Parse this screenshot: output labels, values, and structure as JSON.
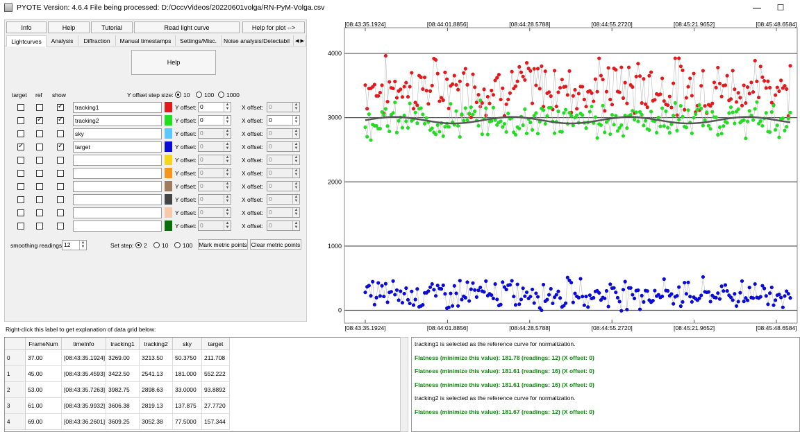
{
  "window": {
    "title": "PYOTE Version: 4.6.4  File being processed: D:/OccvVideos/20220601volga/RN-PyM-Volga.csv",
    "minimize": "—",
    "maximize": "☐"
  },
  "toolbar": {
    "info": "Info",
    "help": "Help",
    "tutorial": "Tutorial",
    "read_light_curve": "Read light curve",
    "help_for_plot": "Help for plot -->"
  },
  "tabs": [
    "Lightcurves",
    "Analysis",
    "Diffraction",
    "Manual timestamps",
    "Settings/Misc.",
    "Noise analysis/Detectabil"
  ],
  "tab_scroll": "◀ ▶",
  "lightcurves": {
    "help_button": "Help",
    "col_target": "target",
    "col_ref": "ref",
    "col_show": "show",
    "y_offset_step_label": "Y offset step size:",
    "y_offset_steps": [
      "10",
      "100",
      "1000"
    ],
    "y_offset_label": "Y offset:",
    "x_offset_label": "X offset:",
    "rows": [
      {
        "name": "tracking1",
        "color": "#e31a1c",
        "target": false,
        "ref": false,
        "show": true,
        "y_offset": "0",
        "x_offset": "0"
      },
      {
        "name": "tracking2",
        "color": "#22dd22",
        "target": false,
        "ref": true,
        "show": true,
        "y_offset": "0",
        "x_offset": "0"
      },
      {
        "name": "sky",
        "color": "#5ac8fa",
        "target": false,
        "ref": false,
        "show": false,
        "y_offset": "0",
        "x_offset": "0"
      },
      {
        "name": "target",
        "color": "#0b0bd6",
        "target": true,
        "ref": false,
        "show": true,
        "y_offset": "0",
        "x_offset": "0"
      },
      {
        "name": "",
        "color": "#f5d61a",
        "target": false,
        "ref": false,
        "show": false,
        "y_offset": "0",
        "x_offset": "0"
      },
      {
        "name": "",
        "color": "#f7941d",
        "target": false,
        "ref": false,
        "show": false,
        "y_offset": "0",
        "x_offset": "0"
      },
      {
        "name": "",
        "color": "#a07a5a",
        "target": false,
        "ref": false,
        "show": false,
        "y_offset": "0",
        "x_offset": "0"
      },
      {
        "name": "",
        "color": "#444444",
        "target": false,
        "ref": false,
        "show": false,
        "y_offset": "0",
        "x_offset": "0"
      },
      {
        "name": "",
        "color": "#f7c9a8",
        "target": false,
        "ref": false,
        "show": false,
        "y_offset": "0",
        "x_offset": "0"
      },
      {
        "name": "",
        "color": "#0a6e0a",
        "target": false,
        "ref": false,
        "show": false,
        "y_offset": "0",
        "x_offset": "0"
      }
    ],
    "smoothing_label": "smoothing readings",
    "smoothing_value": "12",
    "set_step_label": "Set step:",
    "set_steps": [
      "2",
      "10",
      "100"
    ],
    "mark_metric": "Mark metric points",
    "clear_metric": "Clear metric points"
  },
  "grid_hint": "Right-click this label to get explanation of data grid below:",
  "table": {
    "columns": [
      "FrameNum",
      "timeInfo",
      "tracking1",
      "tracking2",
      "sky",
      "target"
    ],
    "rows": [
      [
        "37.00",
        "[08:43:35.1924]",
        "3269.00",
        "3213.50",
        "50.3750",
        "211.708"
      ],
      [
        "45.00",
        "[08:43:35.4593]",
        "3422.50",
        "2541.13",
        "181.000",
        "552.222"
      ],
      [
        "53.00",
        "[08:43:35.7263]",
        "3982.75",
        "2898.63",
        "33.0000",
        "93.8892"
      ],
      [
        "61.00",
        "[08:43:35.9932]",
        "3606.38",
        "2819.13",
        "137.875",
        "27.7720"
      ],
      [
        "69.00",
        "[08:43:36.2601]",
        "3609.25",
        "3052.38",
        "77.5000",
        "157.344"
      ]
    ],
    "row_index": [
      "0",
      "1",
      "2",
      "3",
      "4"
    ]
  },
  "log": [
    {
      "text": "tracking1 is selected as the reference curve for normalization.",
      "green": false
    },
    {
      "text": "Flatness (minimize this value): 181.78 (readings: 12) (X offset: 0)",
      "green": true
    },
    {
      "text": "Flatness (minimize this value): 181.61 (readings: 16) (X offset: 0)",
      "green": true
    },
    {
      "text": "Flatness (minimize this value): 181.61 (readings: 16) (X offset: 0)",
      "green": true
    },
    {
      "text": "tracking2 is selected as the reference curve for normalization.",
      "green": false
    },
    {
      "text": "Flatness (minimize this value): 181.67 (readings: 12) (X offset: 0)",
      "green": true
    }
  ],
  "chart_data": {
    "type": "scatter",
    "x_tick_labels": [
      "[08:43:35.1924]",
      "[08:44:01.8856]",
      "[08:44:28.5788]",
      "[08:44:55.2720]",
      "[08:45:21.9652]",
      "[08:45:48.6584]"
    ],
    "y_ticks": [
      0,
      1000,
      2000,
      3000,
      4000
    ],
    "ylim": [
      -200,
      4400
    ],
    "grid": true,
    "series": [
      {
        "name": "tracking1",
        "color": "#e31a1c",
        "mean": 3480,
        "spread": 380
      },
      {
        "name": "tracking2",
        "color": "#22dd22",
        "mean": 2960,
        "spread": 230
      },
      {
        "name": "target",
        "color": "#0b0bd6",
        "mean": 260,
        "spread": 200
      }
    ],
    "smoothed_line": {
      "color": "#555555",
      "mean": 2960,
      "amplitude": 50
    }
  }
}
